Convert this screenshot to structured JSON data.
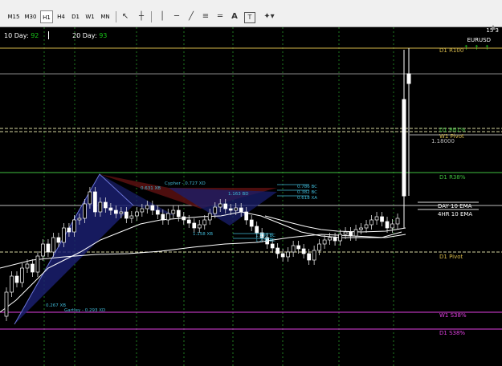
{
  "toolbar": {
    "timeframes": [
      {
        "label": "M15",
        "active": false
      },
      {
        "label": "M30",
        "active": false
      },
      {
        "label": "H1",
        "active": true
      },
      {
        "label": "H4",
        "active": false
      },
      {
        "label": "D1",
        "active": false
      },
      {
        "label": "W1",
        "active": false
      },
      {
        "label": "MN",
        "active": false
      }
    ],
    "tools": [
      "cursor-icon",
      "crosshair-icon",
      "vertical-line-icon",
      "horizontal-line-icon",
      "trendline-icon",
      "fibonacci-icon",
      "text-icon",
      "text-label-icon",
      "shapes-dropdown-icon"
    ],
    "text_tool_label": "A",
    "text_label_tool_label": "T"
  },
  "info": {
    "ten_day_label": "10 Day:",
    "ten_day_value": "92",
    "twenty_day_label": "20 Day:",
    "twenty_day_value": "93"
  },
  "symbol": "EURUSD",
  "clock": "15 3",
  "levels": {
    "d1_r100": "D1 R100",
    "d1_r61": "D1 R61%",
    "w1_pivot": "W1 Pivot",
    "price_118": "1.18000",
    "d1_r38": "D1 R38%",
    "day10ema": "DAY 10 EMA",
    "hr4_10ema": "4HR 10 EMA",
    "d1_pivot": "D1 Pivot",
    "w1_s38": "W1 S38%",
    "d1_s38": "D1 S38%"
  },
  "patterns": {
    "cypher": "Cypher - 0.727 XD",
    "xb1": "0.631 XB",
    "bd1": "1.163 BD",
    "bc1": "0.786 BC",
    "bc2": "0.382 BC",
    "xa1": "0.618 XA",
    "xb2": "1.158 XB",
    "bc3": "1.130 BC",
    "bc4": "1.270 BC",
    "xb3": "0.267 XB",
    "gartley": "Gartley - 0.293 XD"
  },
  "colors": {
    "ok": "#19c819",
    "level_gold": "#d6b94a",
    "level_green": "#3fbf3f",
    "level_magenta": "#e040e0",
    "harmonic_blue": "#1a1f6e",
    "harmonic_red": "#5a1010"
  }
}
